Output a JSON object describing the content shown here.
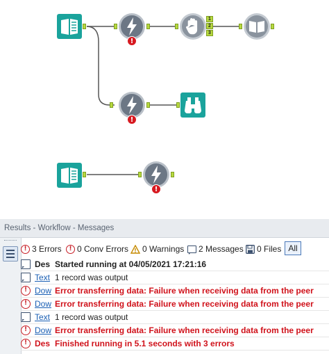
{
  "results": {
    "header_title": "Results - Workflow - Messages",
    "filters": {
      "errors": "3 Errors",
      "conv_errors": "0 Conv Errors",
      "warnings": "0 Warnings",
      "messages": "2 Messages",
      "files": "0 Files",
      "all": "All"
    },
    "rows": [
      {
        "type": "message",
        "col": "Des",
        "col_link": false,
        "text": "Started running at 04/05/2021 17:21:16",
        "style": "bold"
      },
      {
        "type": "message",
        "col": "Text",
        "col_link": true,
        "text": "1 record was output",
        "style": "normal"
      },
      {
        "type": "error",
        "col": "Dow",
        "col_link": true,
        "text": "Error transferring data: Failure when receiving data from the peer",
        "style": "error"
      },
      {
        "type": "error",
        "col": "Dow",
        "col_link": true,
        "text": "Error transferring data: Failure when receiving data from the peer",
        "style": "error"
      },
      {
        "type": "message",
        "col": "Text",
        "col_link": true,
        "text": "1 record was output",
        "style": "normal"
      },
      {
        "type": "error",
        "col": "Dow",
        "col_link": true,
        "text": "Error transferring data: Failure when receiving data from the peer",
        "style": "error"
      },
      {
        "type": "error",
        "col": "Des",
        "col_link": false,
        "text": "Finished running in 5.1 seconds with 3 errors",
        "style": "error"
      }
    ]
  },
  "canvas": {
    "error_badge": "!",
    "join_anchor_labels": [
      "1",
      "2",
      "3"
    ],
    "tools": [
      "text-input-tool-1",
      "download-tool-1",
      "manual-hold-tool",
      "browse-output-tool",
      "download-tool-2",
      "browse-tool",
      "text-input-tool-2",
      "download-tool-3"
    ]
  },
  "colors": {
    "text_input_teal": "#1aa39c",
    "download_gray": "#6c7785",
    "connection_green": "#b7d93f",
    "error_red": "#d71920",
    "error_text": "#d0121b",
    "link_blue": "#1a5fb4"
  }
}
